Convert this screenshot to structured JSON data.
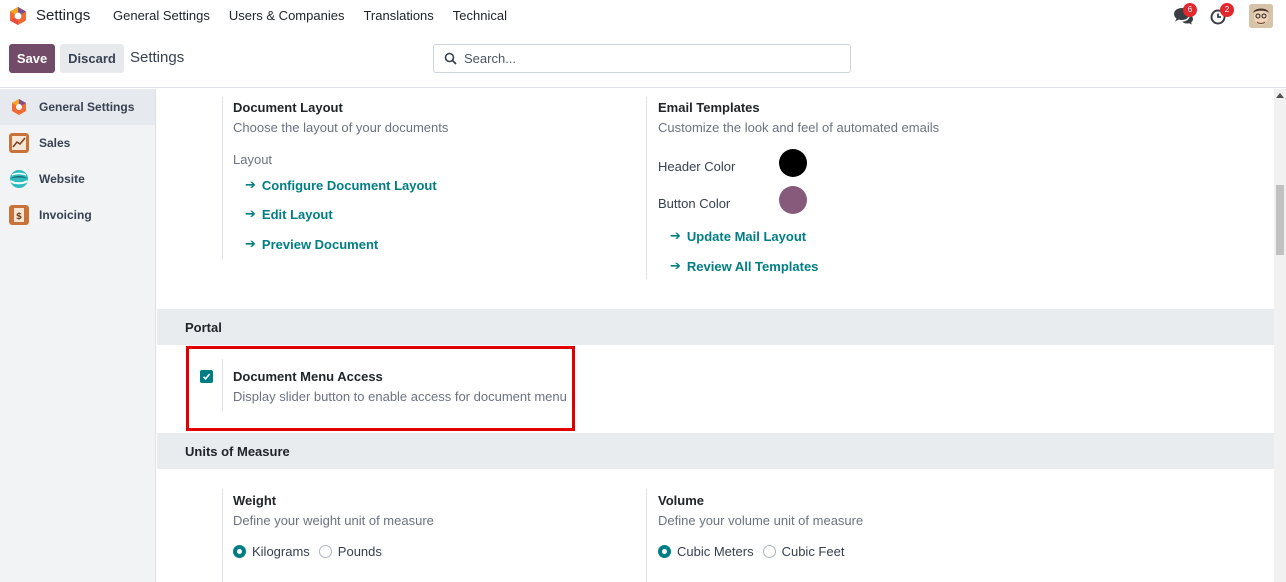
{
  "navbar": {
    "app_name": "Settings",
    "menu": [
      "General Settings",
      "Users & Companies",
      "Translations",
      "Technical"
    ],
    "messages_count": "6",
    "activities_count": "2"
  },
  "control_panel": {
    "save_label": "Save",
    "discard_label": "Discard",
    "title": "Settings",
    "search_placeholder": "Search..."
  },
  "sidebar": {
    "items": [
      {
        "label": "General Settings",
        "icon": "odoo-logo-icon",
        "active": true
      },
      {
        "label": "Sales",
        "icon": "sales-chart-icon",
        "active": false
      },
      {
        "label": "Website",
        "icon": "website-globe-icon",
        "active": false
      },
      {
        "label": "Invoicing",
        "icon": "invoicing-icon",
        "active": false
      }
    ]
  },
  "document_layout": {
    "title": "Document Layout",
    "description": "Choose the layout of your documents",
    "sub_label": "Layout",
    "links": [
      "Configure Document Layout",
      "Edit Layout",
      "Preview Document"
    ]
  },
  "email_templates": {
    "title": "Email Templates",
    "description": "Customize the look and feel of automated emails",
    "header_color_label": "Header Color",
    "header_color": "#000000",
    "button_color_label": "Button Color",
    "button_color": "#875a7b",
    "links": [
      "Update Mail Layout",
      "Review All Templates"
    ]
  },
  "portal": {
    "section_title": "Portal",
    "document_menu_access": {
      "title": "Document Menu Access",
      "description": "Display slider button to enable access for document menu",
      "checked": true
    }
  },
  "units_of_measure": {
    "section_title": "Units of Measure",
    "weight": {
      "title": "Weight",
      "description": "Define your weight unit of measure",
      "options": [
        "Kilograms",
        "Pounds"
      ],
      "selected": "Kilograms"
    },
    "volume": {
      "title": "Volume",
      "description": "Define your volume unit of measure",
      "options": [
        "Cubic Meters",
        "Cubic Feet"
      ],
      "selected": "Cubic Meters"
    }
  },
  "colors": {
    "brand": "#714b67",
    "accent": "#017e84",
    "highlight": "#e00000"
  }
}
